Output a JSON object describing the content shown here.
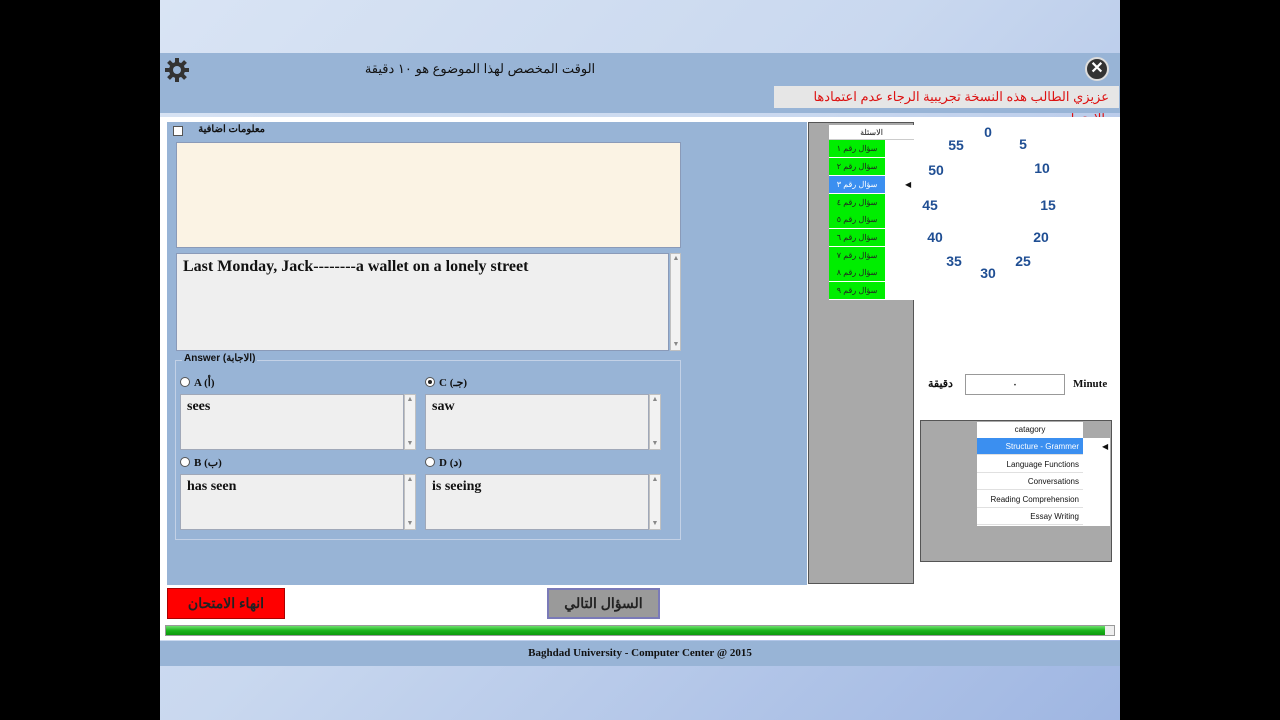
{
  "header": {
    "title": "الوقت المخصص لهذا الموضوع هو ١٠ دقيقة",
    "warning": "عزيزي الطالب هذه النسخة تجريبية الرجاء عدم اعتمادها بالامتحان"
  },
  "extra_info": {
    "label": "معلومات اضافية",
    "checked": false
  },
  "question": {
    "text": "Last Monday, Jack--------a wallet on a lonely street"
  },
  "answer": {
    "legend": "Answer (الاجابة)",
    "options": [
      {
        "label": "A (أ)",
        "text": "sees",
        "selected": false
      },
      {
        "label": "C (جـ)",
        "text": "saw",
        "selected": true
      },
      {
        "label": "B (ب)",
        "text": "has seen",
        "selected": false
      },
      {
        "label": "D (د)",
        "text": "is seeing",
        "selected": false
      }
    ]
  },
  "questions_list": {
    "header": "الاسئلة",
    "items": [
      {
        "label": "سؤال رقم ١",
        "selected": false
      },
      {
        "label": "سؤال رقم ٢",
        "selected": false
      },
      {
        "label": "سؤال رقم ٣",
        "selected": true
      },
      {
        "label": "سؤال رقم ٤",
        "selected": false
      },
      {
        "label": "سؤال رقم ٥",
        "selected": false
      },
      {
        "label": "سؤال رقم ٦",
        "selected": false
      },
      {
        "label": "سؤال رقم ٧",
        "selected": false
      },
      {
        "label": "سؤال رقم ٨",
        "selected": false
      },
      {
        "label": "سؤال رقم ٩",
        "selected": false
      }
    ]
  },
  "timer": {
    "ticks": [
      "0",
      "5",
      "10",
      "15",
      "20",
      "25",
      "30",
      "35",
      "40",
      "45",
      "50",
      "55"
    ],
    "minute_label": "Minute",
    "minute_value": "٠",
    "minute_label_ar": "دقيقة"
  },
  "category": {
    "header": "catagory",
    "items": [
      {
        "label": "Structure - Grammer",
        "selected": true
      },
      {
        "label": "Language Functions",
        "selected": false
      },
      {
        "label": "Conversations",
        "selected": false
      },
      {
        "label": "Reading Comprehension",
        "selected": false
      },
      {
        "label": "Essay Writing",
        "selected": false
      }
    ]
  },
  "buttons": {
    "end_exam": "انهاء الامتحان",
    "next_question": "السؤال التالي"
  },
  "progress": {
    "value": 0.99
  },
  "footer": "Baghdad University - Computer Center @ 2015",
  "colors": {
    "accent": "#3b8ff0",
    "answered": "#00ee00",
    "danger": "#ff0000",
    "panel": "#98b4d6",
    "timer_text": "#1f4e93"
  },
  "icons": {
    "settings": "gear-icon",
    "close": "close-icon"
  }
}
